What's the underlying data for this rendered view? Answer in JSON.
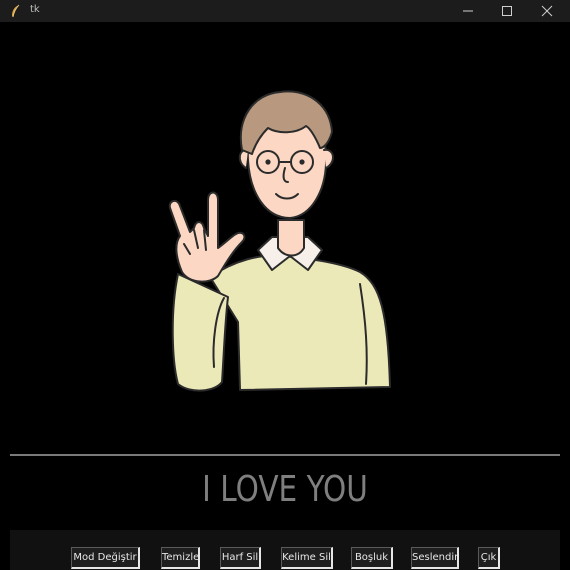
{
  "window": {
    "title": "tk",
    "controls": [
      "minimize-icon",
      "maximize-icon",
      "close-icon"
    ]
  },
  "output": {
    "text": "I LOVE YOU"
  },
  "buttons": [
    {
      "label": "Mod Değiştir"
    },
    {
      "label": "Temizle"
    },
    {
      "label": "Harf Sil"
    },
    {
      "label": "Kelime Sil"
    },
    {
      "label": "Boşluk"
    },
    {
      "label": "Seslendir"
    },
    {
      "label": "Çık"
    }
  ],
  "colors": {
    "background": "#000000",
    "titlebar": "#1c1c1c",
    "output_text": "#7f7f7f",
    "button_bar": "#111111",
    "button_face": "#1e1e1e",
    "sweater": "#ece9b8",
    "skin": "#fbd7c4",
    "hair": "#b8987e"
  }
}
